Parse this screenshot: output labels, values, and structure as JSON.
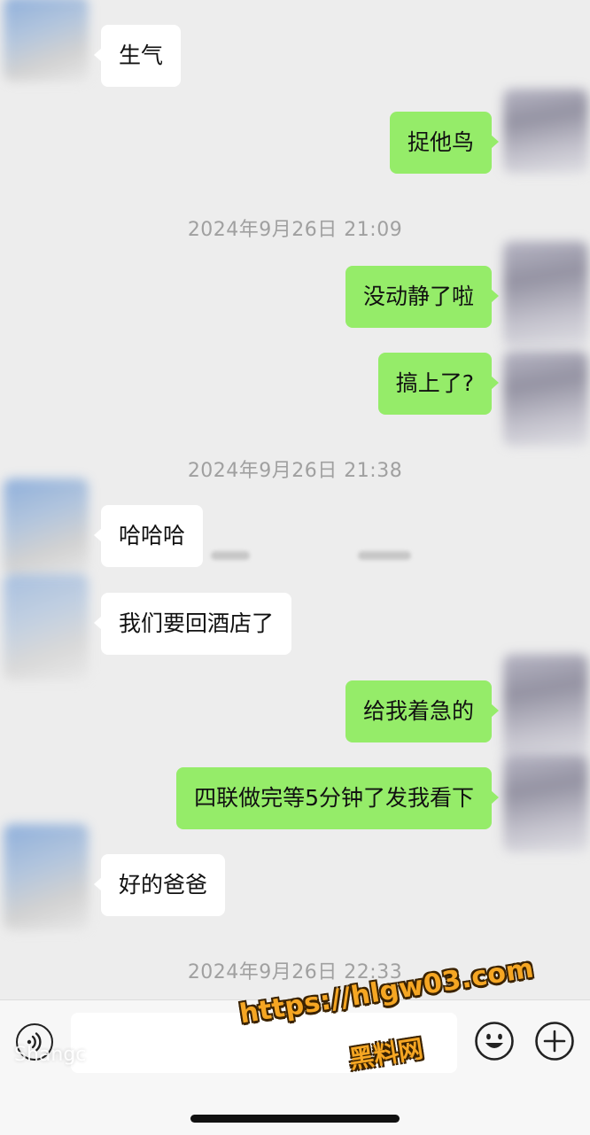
{
  "messages": [
    {
      "side": "in",
      "text": "生气"
    },
    {
      "side": "out",
      "text": "捉他鸟"
    },
    {
      "side": "out",
      "text": "没动静了啦"
    },
    {
      "side": "out",
      "text": "搞上了?"
    },
    {
      "side": "in",
      "text": "哈哈哈"
    },
    {
      "side": "in",
      "text": "我们要回酒店了"
    },
    {
      "side": "out",
      "text": "给我着急的"
    },
    {
      "side": "out",
      "text": "四联做完等5分钟了发我看下"
    },
    {
      "side": "in",
      "text": "好的爸爸"
    }
  ],
  "timestamps": [
    "2024年9月26日  21:09",
    "2024年9月26日  21:38",
    "2024年9月26日  22:33"
  ],
  "input_bar": {
    "placeholder": "",
    "ghost_text": "Shangc"
  },
  "watermark": {
    "url": "https://hlgw03.com",
    "name": "黑料网"
  },
  "colors": {
    "background": "#ededed",
    "outgoing_bubble": "#95ec69",
    "incoming_bubble": "#ffffff",
    "timestamp_text": "#a0a0a0",
    "watermark": "#f5a623"
  },
  "icons": [
    "voice-icon",
    "emoji-icon",
    "plus-icon"
  ]
}
